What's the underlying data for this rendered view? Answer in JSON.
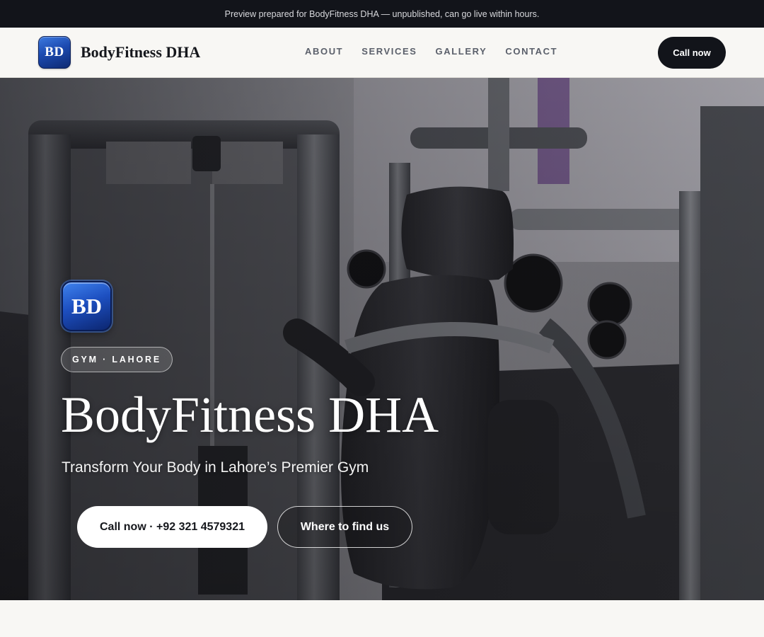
{
  "preview_bar": {
    "text": "Preview prepared for BodyFitness DHA — unpublished, can go live within hours."
  },
  "header": {
    "logo_initials": "BD",
    "brand_name": "BodyFitness DHA",
    "nav": [
      {
        "label": "ABOUT"
      },
      {
        "label": "SERVICES"
      },
      {
        "label": "GALLERY"
      },
      {
        "label": "CONTACT"
      }
    ],
    "call_button": "Call now"
  },
  "hero": {
    "logo_initials": "BD",
    "tag": "GYM · LAHORE",
    "title": "BodyFitness DHA",
    "subtitle": "Transform Your Body in Lahore’s Premier Gym",
    "primary_button": "Call now · +92 321 4579321",
    "secondary_button": "Where to find us",
    "background_image": "gym-machines-photo"
  },
  "colors": {
    "dark": "#12141a",
    "page_bg": "#f8f7f4",
    "logo_blue": "#1c4ab0",
    "nav_text": "#5b606b"
  }
}
